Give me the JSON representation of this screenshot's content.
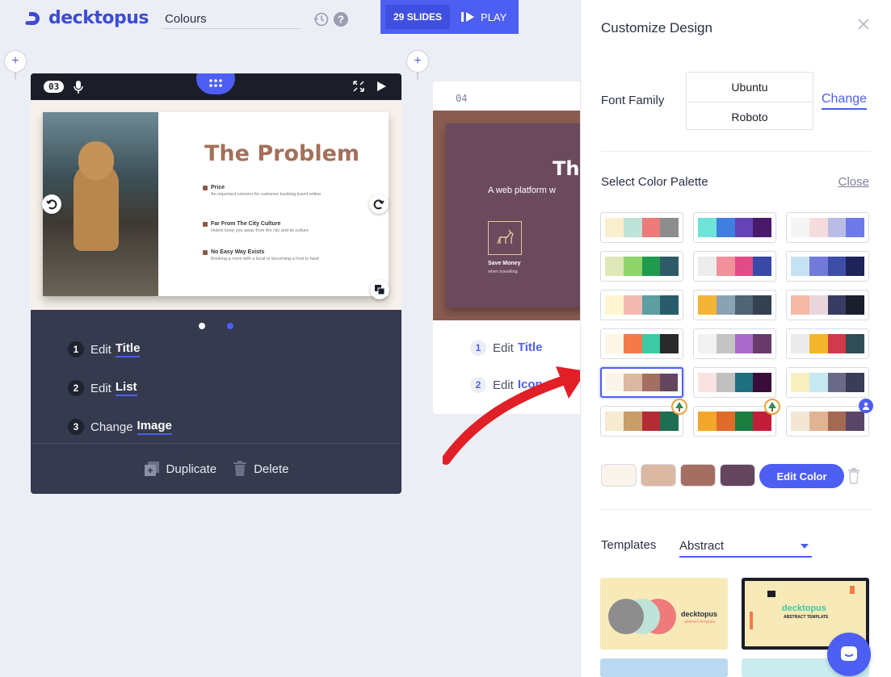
{
  "app": {
    "brand": "decktopus",
    "presentation_title": "Colours",
    "slides_count_label": "29 SLIDES",
    "play_label": "PLAY"
  },
  "slide3": {
    "number": "03",
    "title": "The Problem",
    "bullets": [
      {
        "heading": "Price",
        "body": "An important concern for customer booking travel online"
      },
      {
        "heading": "Far From The City Culture",
        "body": "Hotels keep you away from the city and its culture"
      },
      {
        "heading": "No Easy Way Exists",
        "body": "Booking a room with a local or becoming a host is hard"
      }
    ],
    "todos": [
      {
        "num": "1",
        "action": "Edit",
        "target": "Title"
      },
      {
        "num": "2",
        "action": "Edit",
        "target": "List"
      },
      {
        "num": "3",
        "action": "Change",
        "target": "Image"
      }
    ],
    "duplicate_label": "Duplicate",
    "delete_label": "Delete"
  },
  "slide4": {
    "number": "04",
    "title_partial": "Th",
    "subtitle_partial": "A web platform w",
    "save_money": "Save Money",
    "save_money_sub": "when travelling",
    "todos": [
      {
        "num": "1",
        "action": "Edit",
        "target": "Title"
      },
      {
        "num": "2",
        "action": "Edit",
        "target": "Icon"
      }
    ]
  },
  "panel": {
    "title": "Customize Design",
    "font_family_label": "Font Family",
    "fonts": [
      "Ubuntu",
      "Roboto"
    ],
    "change_label": "Change",
    "select_palette_label": "Select Color Palette",
    "close_label": "Close",
    "palettes": [
      [
        "#f9efcf",
        "#bfe3d8",
        "#ef7a7a",
        "#8d8d8d"
      ],
      [
        "#6fe3d8",
        "#3f7fe0",
        "#6542b5",
        "#4a1a6a"
      ],
      [
        "#f5f5f5",
        "#f5dcdc",
        "#b9bde6",
        "#6c79e8"
      ],
      [
        "#dfe8b8",
        "#8ed46a",
        "#1f9a4e",
        "#2f5b68"
      ],
      [
        "#ececec",
        "#f2909b",
        "#e14b88",
        "#3949a8"
      ],
      [
        "#c6e2f2",
        "#7279d9",
        "#3e4da8",
        "#1e2458"
      ],
      [
        "#fdf6d0",
        "#f2b9b2",
        "#5e9ea0",
        "#2a5b6b"
      ],
      [
        "#f2b535",
        "#8aa3b3",
        "#4f6575",
        "#354150"
      ],
      [
        "#f5b9a5",
        "#e9d6dd",
        "#393c62",
        "#1b1e2c"
      ],
      [
        "#fdf6e7",
        "#f47a4a",
        "#3ccba4",
        "#2a2a2a"
      ],
      [
        "#f2f2f2",
        "#c4c4c4",
        "#a96ac9",
        "#6a3a6a"
      ],
      [
        "#ebebeb",
        "#f2b62a",
        "#cf3a4c",
        "#2f4d56"
      ],
      [
        "#fbf4eb",
        "#dbb8a1",
        "#a46e62",
        "#64465e"
      ],
      [
        "#f8e2e2",
        "#c0c0c0",
        "#1f6f80",
        "#3a0c3a"
      ],
      [
        "#f8f0c0",
        "#c6e8f0",
        "#6a6a88",
        "#3b3c55"
      ],
      [
        "#f6ead0",
        "#c79e6a",
        "#b32c35",
        "#1f6e53"
      ],
      [
        "#f3a72a",
        "#e06a2a",
        "#1c7d3e",
        "#c21e3a"
      ],
      [
        "#f2e6d4",
        "#e0b493",
        "#a26a52",
        "#5a4566"
      ]
    ],
    "selected_palette": 12,
    "current_colors": [
      "#fbf4eb",
      "#dbb8a1",
      "#a46e62",
      "#64465e"
    ],
    "edit_color_label": "Edit Color",
    "templates_label": "Templates",
    "templates_value": "Abstract",
    "template_a_brand": "decktopus",
    "template_a_sub": "abstract template",
    "template_b_brand": "decktopus",
    "template_b_sub": "ABSTRACT TEMPLATE"
  }
}
